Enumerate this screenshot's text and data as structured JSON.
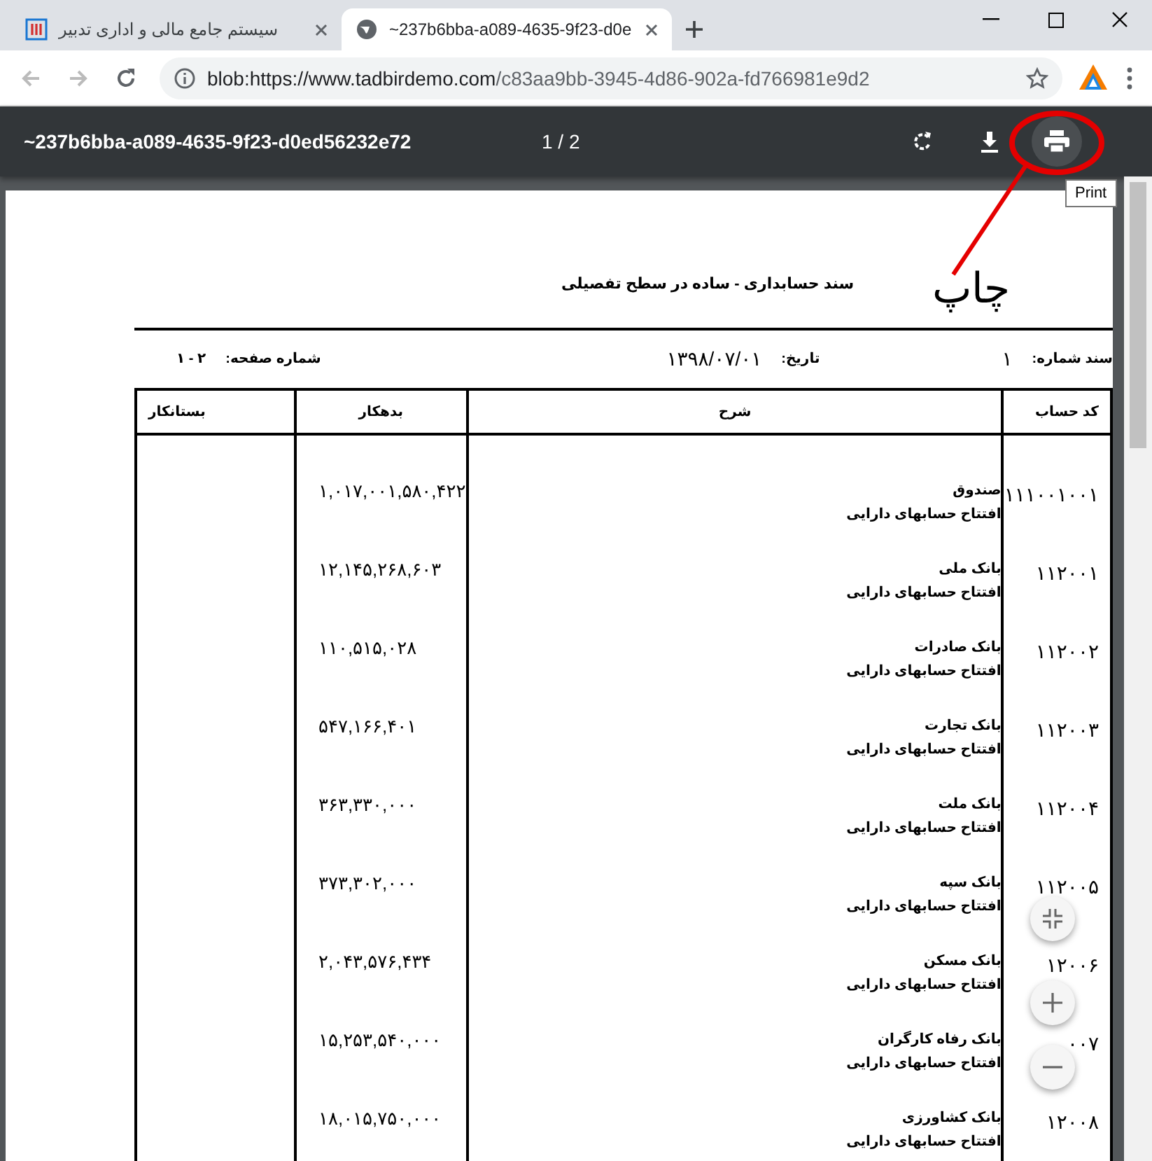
{
  "tab_strip": {
    "left_tab": {
      "title": "سیستم جامع مالی و اداری تدبیر",
      "selected": false
    },
    "right_tab": {
      "title": "~237b6bba-a089-4635-9f23-d0e",
      "selected": true
    }
  },
  "address_bar": {
    "url_host": "blob:https://www.tadbirdemo.com",
    "url_path": "/c83aa9bb-3945-4d86-902a-fd766981e9d2"
  },
  "pdf_toolbar": {
    "file_name": "~237b6bba-a089-4635-9f23-d0ed56232e72",
    "page_indicator": "1 / 2"
  },
  "tooltip": "Print",
  "annotation": "چاپ",
  "document": {
    "title": "سند حسابداری - ساده در سطح تفصیلی",
    "voucher_label": "سند شماره:",
    "voucher_number": "۱",
    "date_label": "تاریخ:",
    "date": "۱۳۹۸/۰۷/۰۱",
    "page_label": "شماره صفحه:",
    "page_value": "۲ - ۱",
    "columns": [
      "کد حساب",
      "شرح",
      "بدهکار",
      "بستانکار"
    ],
    "rows": [
      {
        "code": "۱۱۱۰۰۱۰۰۱",
        "account": "صندوق",
        "description": "افتتاح حسابهای دارایی",
        "debit": "۱,۰۱۷,۰۰۱,۵۸۰,۴۲۲"
      },
      {
        "code": "۱۱۲۰۰۱",
        "account": "بانک ملی",
        "description": "افتتاح حسابهای دارایی",
        "debit": "۱۲,۱۴۵,۲۶۸,۶۰۳"
      },
      {
        "code": "۱۱۲۰۰۲",
        "account": "بانک صادرات",
        "description": "افتتاح حسابهای دارایی",
        "debit": "۱۱۰,۵۱۵,۰۲۸"
      },
      {
        "code": "۱۱۲۰۰۳",
        "account": "بانک تجارت",
        "description": "افتتاح حسابهای دارایی",
        "debit": "۵۴۷,۱۶۶,۴۰۱"
      },
      {
        "code": "۱۱۲۰۰۴",
        "account": "بانک ملت",
        "description": "افتتاح حسابهای دارایی",
        "debit": "۳۶۳,۳۳۰,۰۰۰"
      },
      {
        "code": "۱۱۲۰۰۵",
        "account": "بانک سپه",
        "description": "افتتاح حسابهای دارایی",
        "debit": "۳۷۳,۳۰۲,۰۰۰"
      },
      {
        "code": "۱۲۰۰۶",
        "account": "بانک مسکن",
        "description": "افتتاح حسابهای دارایی",
        "debit": "۲,۰۴۳,۵۷۶,۴۳۴"
      },
      {
        "code": "۰۰۷",
        "account": "بانک رفاه کارگران",
        "description": "افتتاح حسابهای دارایی",
        "debit": "۱۵,۲۵۳,۵۴۰,۰۰۰"
      },
      {
        "code": "۱۲۰۰۸",
        "account": "بانک کشاورزی",
        "description": "افتتاح حسابهای دارایی",
        "debit": "۱۸,۰۱۵,۷۵۰,۰۰۰"
      }
    ]
  }
}
